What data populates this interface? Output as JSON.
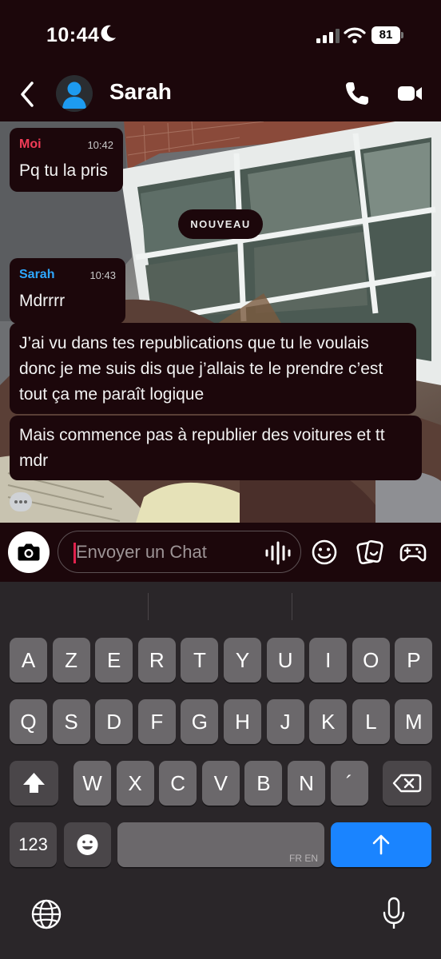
{
  "status_bar": {
    "time": "10:44",
    "battery": "81"
  },
  "header": {
    "contact_name": "Sarah"
  },
  "messages": {
    "new_divider": "NOUVEAU",
    "m1": {
      "sender": "Moi",
      "time": "10:42",
      "text": "Pq tu la pris",
      "sender_color": "#f23c57"
    },
    "m2": {
      "sender": "Sarah",
      "time": "10:43",
      "text": "Mdrrrr",
      "sender_color": "#2ea7ff"
    },
    "m3": {
      "line1": "J’ai vu dans tes republications que tu le voulais",
      "line2": "donc je me suis dis que j’allais te le prendre c’est",
      "line3": "tout ça me paraît logique"
    },
    "m4": {
      "line1": "Mais commence pas à republier des voitures et tt",
      "line2": "mdr"
    }
  },
  "input": {
    "placeholder": "Envoyer un Chat"
  },
  "keyboard": {
    "row1": [
      "A",
      "Z",
      "E",
      "R",
      "T",
      "Y",
      "U",
      "I",
      "O",
      "P"
    ],
    "row2": [
      "Q",
      "S",
      "D",
      "F",
      "G",
      "H",
      "J",
      "K",
      "L",
      "M"
    ],
    "row3": [
      "W",
      "X",
      "C",
      "V",
      "B",
      "N",
      "´"
    ],
    "numbers_label": "123",
    "space_lang_label": "FR EN"
  }
}
